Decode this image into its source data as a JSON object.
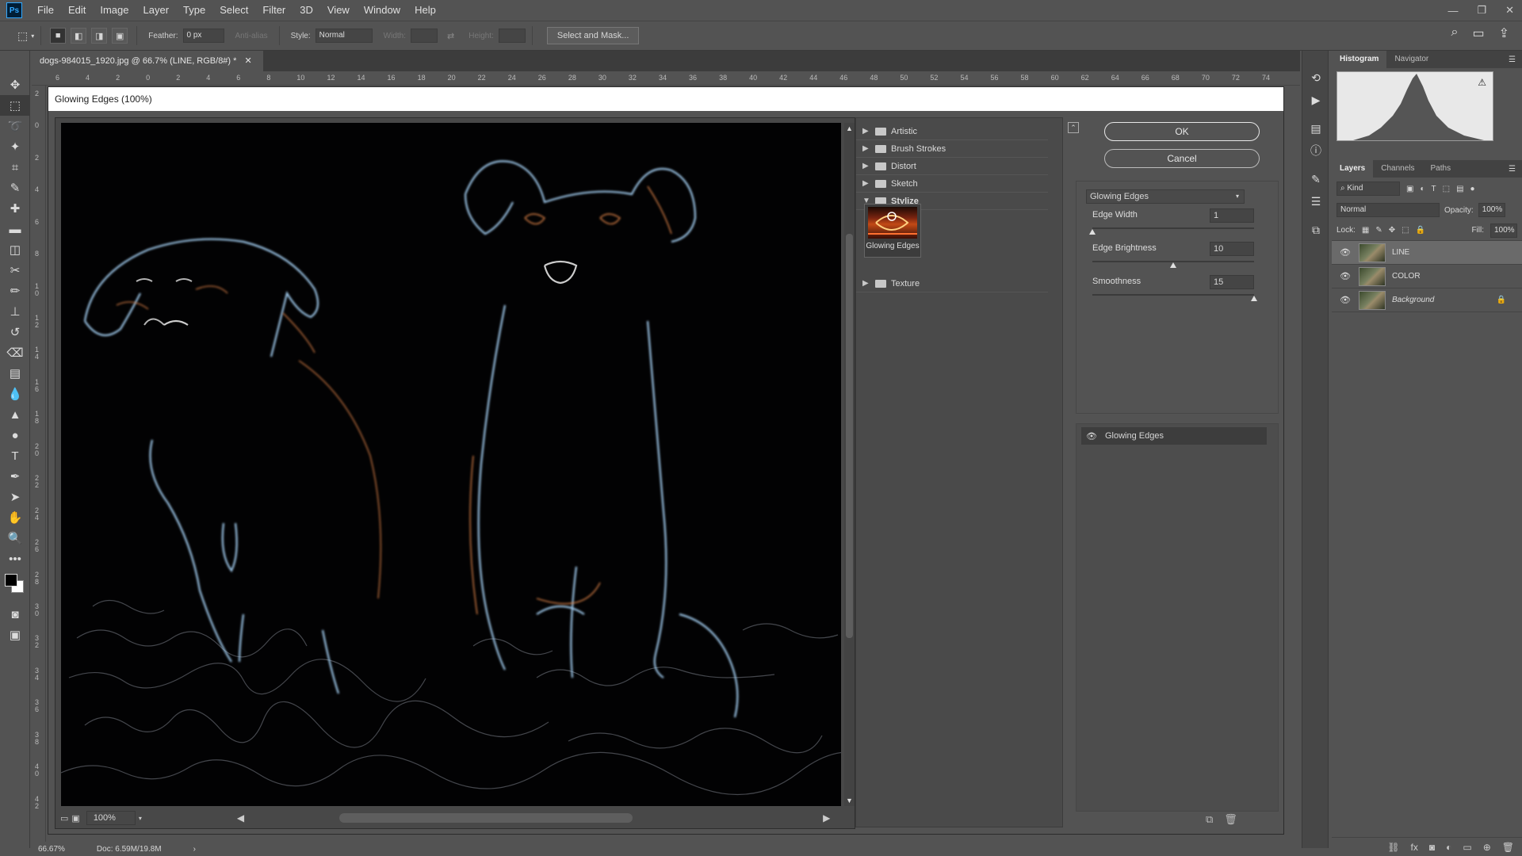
{
  "menubar": {
    "app_logo": "Ps",
    "items": [
      "File",
      "Edit",
      "Image",
      "Layer",
      "Type",
      "Select",
      "Filter",
      "3D",
      "View",
      "Window",
      "Help"
    ]
  },
  "options": {
    "feather_label": "Feather:",
    "feather_value": "0 px",
    "antialias": "Anti-alias",
    "style_label": "Style:",
    "style_value": "Normal",
    "width_label": "Width:",
    "height_label": "Height:",
    "select_mask": "Select and Mask..."
  },
  "document": {
    "tab_title": "dogs-984015_1920.jpg @ 66.7% (LINE, RGB/8#) *",
    "ruler_top": [
      "6",
      "4",
      "2",
      "0",
      "2",
      "4",
      "6",
      "8",
      "10",
      "12",
      "14",
      "16",
      "18",
      "20",
      "22",
      "24",
      "26",
      "28",
      "30",
      "32",
      "34",
      "36",
      "38",
      "40",
      "42",
      "44",
      "46",
      "48",
      "50",
      "52",
      "54",
      "56",
      "58",
      "60",
      "62",
      "64",
      "66",
      "68",
      "70",
      "72",
      "74"
    ],
    "ruler_left": [
      "2",
      "0",
      "2",
      "4",
      "6",
      "8",
      "1 0",
      "1 2",
      "1 4",
      "1 6",
      "1 8",
      "2 0",
      "2 2",
      "2 4",
      "2 6",
      "2 8",
      "3 0",
      "3 2",
      "3 4",
      "3 6",
      "3 8",
      "4 0",
      "4 2"
    ],
    "zoom_status": "66.67%",
    "doc_status": "Doc: 6.59M/19.8M"
  },
  "dialog": {
    "title": "Glowing Edges (100%)",
    "zoom": "100%",
    "categories": [
      {
        "label": "Artistic",
        "open": false
      },
      {
        "label": "Brush Strokes",
        "open": false
      },
      {
        "label": "Distort",
        "open": false
      },
      {
        "label": "Sketch",
        "open": false
      },
      {
        "label": "Stylize",
        "open": true
      },
      {
        "label": "Texture",
        "open": false
      }
    ],
    "thumbnail_label": "Glowing Edges",
    "ok": "OK",
    "cancel": "Cancel",
    "filter_select": "Glowing Edges",
    "params": [
      {
        "label": "Edge Width",
        "value": "1",
        "fraction": 0.0
      },
      {
        "label": "Edge Brightness",
        "value": "10",
        "fraction": 0.5
      },
      {
        "label": "Smoothness",
        "value": "15",
        "fraction": 1.0
      }
    ],
    "effect_layer": "Glowing Edges"
  },
  "panels": {
    "top_tabs": [
      "Histogram",
      "Navigator"
    ],
    "layer_tabs": [
      "Layers",
      "Channels",
      "Paths"
    ],
    "kind": "Kind",
    "blend": "Normal",
    "opacity_label": "Opacity:",
    "opacity": "100%",
    "lock_label": "Lock:",
    "fill_label": "Fill:",
    "fill": "100%",
    "layers": [
      {
        "name": "LINE",
        "selected": true,
        "locked": false
      },
      {
        "name": "COLOR",
        "selected": false,
        "locked": false
      },
      {
        "name": "Background",
        "selected": false,
        "locked": true
      }
    ]
  }
}
